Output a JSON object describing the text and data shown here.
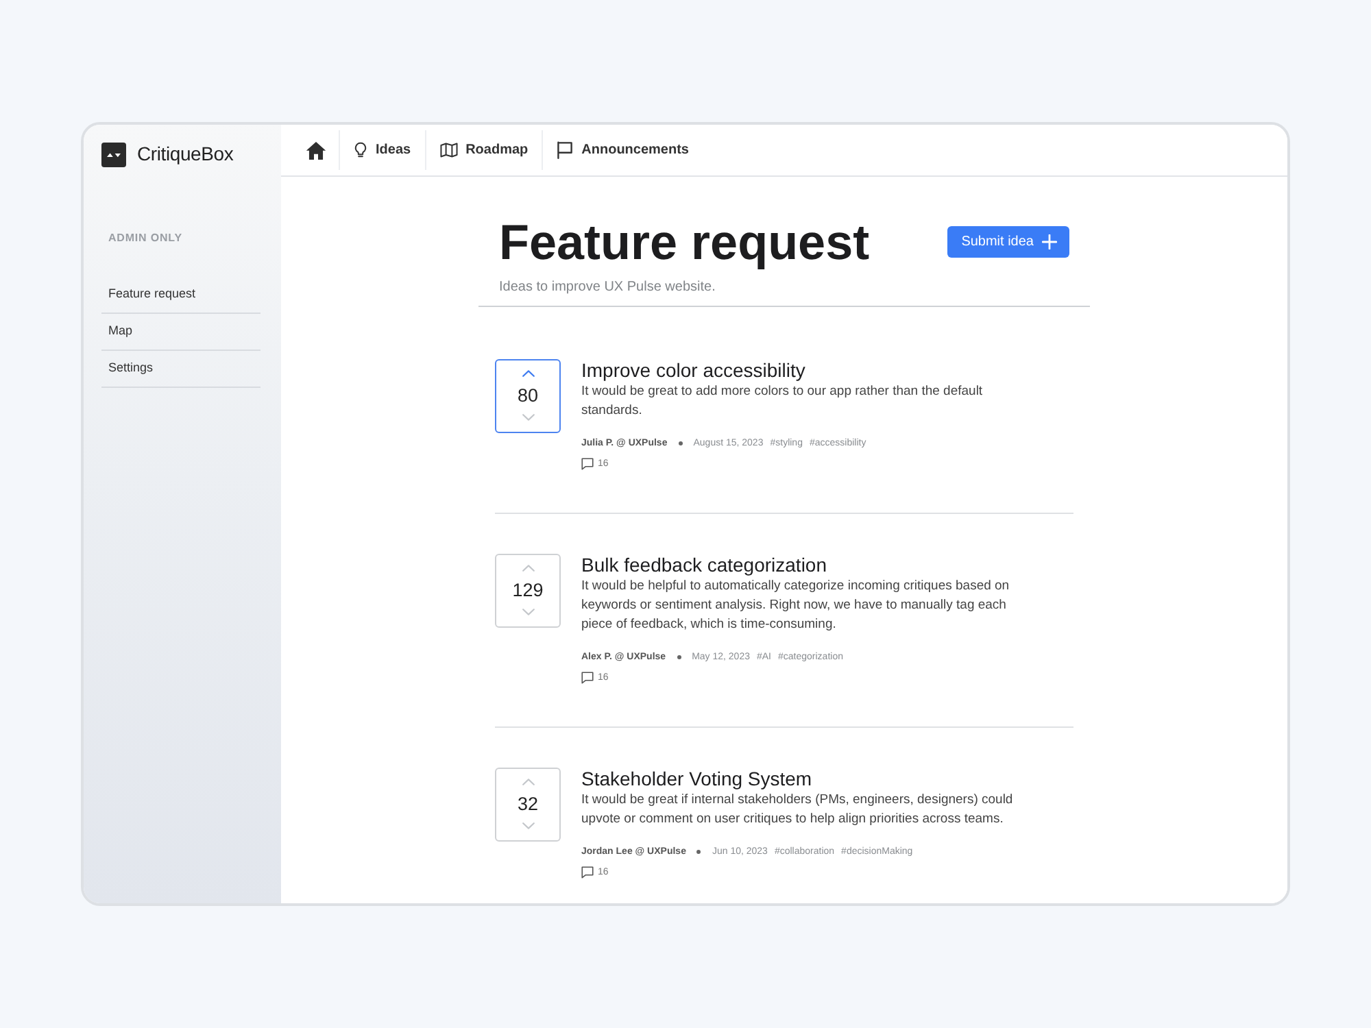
{
  "app": {
    "logo": "CritiqueBox"
  },
  "sidebar": {
    "section_label": "ADMIN ONLY",
    "items": [
      "Feature request",
      "Map",
      "Settings"
    ]
  },
  "top_nav": {
    "links": [
      "Ideas",
      "Roadmap",
      "Announcements"
    ]
  },
  "header": {
    "title": "Feature request",
    "subtitle": "Ideas to improve UX Pulse website.",
    "submit_button": "Submit idea"
  },
  "ideas": [
    {
      "votes": "80",
      "upvoted": true,
      "title": "Improve color accessibility",
      "description": "It would be great to add more colors to our app rather than the default standards.",
      "author": "Julia P. @ UXPulse",
      "date": "August 15, 2023",
      "tags": [
        "#styling",
        "#accessibility"
      ],
      "comments": "16"
    },
    {
      "votes": "129",
      "upvoted": false,
      "title": "Bulk feedback categorization",
      "description": "It would be helpful to automatically categorize incoming critiques based on keywords or sentiment analysis. Right now, we have to manually tag each piece of feedback, which is time-consuming.",
      "author": "Alex P. @ UXPulse",
      "date": "May 12, 2023",
      "tags": [
        "#AI",
        "#categorization"
      ],
      "comments": "16"
    },
    {
      "votes": "32",
      "upvoted": false,
      "title": "Stakeholder Voting System",
      "description": "It would be great if internal stakeholders (PMs, engineers, designers) could upvote or comment on user critiques to help align priorities across teams.",
      "author": "Jordan Lee @ UXPulse",
      "date": "Jun 10, 2023",
      "tags": [
        "#collaboration",
        "#decisionMaking"
      ],
      "comments": "16"
    }
  ]
}
